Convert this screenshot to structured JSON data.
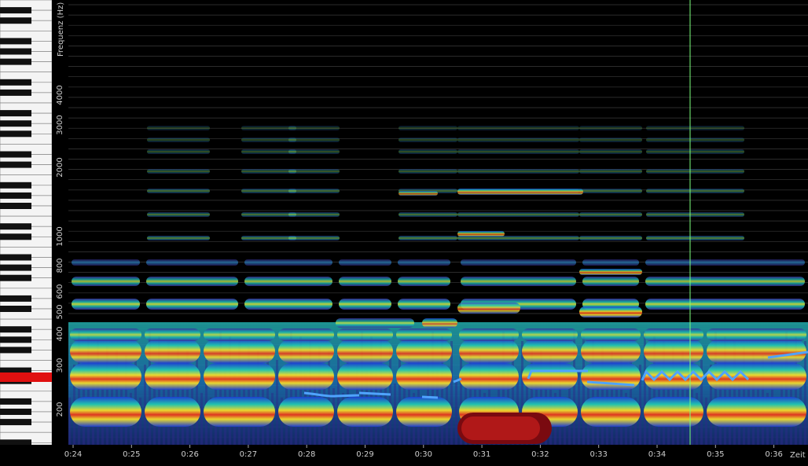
{
  "freq_axis": {
    "title": "Frequenz (Hz)",
    "ticks": [
      "4000",
      "3000",
      "2000",
      "1000",
      "800",
      "600",
      "500",
      "400",
      "300",
      "200"
    ]
  },
  "time_axis": {
    "title": "Zeit",
    "ticks": [
      "0:24",
      "0:25",
      "0:26",
      "0:27",
      "0:28",
      "0:29",
      "0:30",
      "0:31",
      "0:32",
      "0:33",
      "0:34",
      "0:35",
      "0:36"
    ]
  },
  "colors": {
    "background": "#000000",
    "cursor": "#7cff7c",
    "pitch_line": "#4fa3ff",
    "piano_highlight": "#e01010"
  },
  "piano": {
    "highlighted_key": "D4"
  }
}
